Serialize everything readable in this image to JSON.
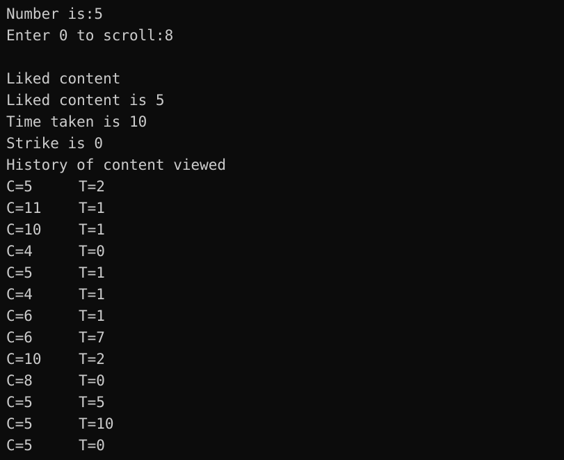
{
  "colors": {
    "background": "#0c0c0c",
    "foreground": "#cccccc"
  },
  "lines": {
    "number_line": "Number is:5",
    "scroll_prompt": "Enter 0 to scroll:8",
    "liked_header": "Liked content",
    "liked_value": "Liked content is 5",
    "time_taken": "Time taken is 10",
    "strike": "Strike is 0",
    "history_header": "History of content viewed"
  },
  "history": [
    {
      "c": "C=5",
      "t": "T=2"
    },
    {
      "c": "C=11",
      "t": "T=1"
    },
    {
      "c": "C=10",
      "t": "T=1"
    },
    {
      "c": "C=4",
      "t": "T=0"
    },
    {
      "c": "C=5",
      "t": "T=1"
    },
    {
      "c": "C=4",
      "t": "T=1"
    },
    {
      "c": "C=6",
      "t": "T=1"
    },
    {
      "c": "C=6",
      "t": "T=7"
    },
    {
      "c": "C=10",
      "t": "T=2"
    },
    {
      "c": "C=8",
      "t": "T=0"
    },
    {
      "c": "C=5",
      "t": "T=5"
    },
    {
      "c": "C=5",
      "t": "T=10"
    },
    {
      "c": "C=5",
      "t": "T=0"
    }
  ]
}
